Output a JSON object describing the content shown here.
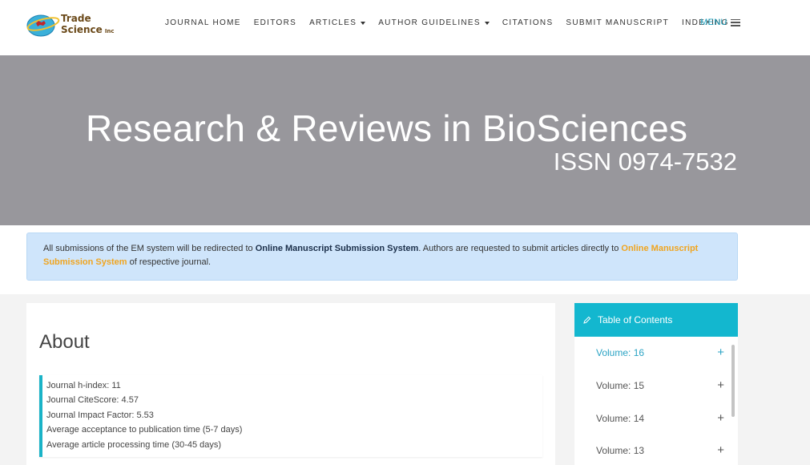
{
  "header": {
    "logo": {
      "line1": "Trade",
      "line2": "Science",
      "suffix": "Inc"
    },
    "nav": [
      {
        "label": "JOURNAL HOME",
        "dropdown": false
      },
      {
        "label": "EDITORS",
        "dropdown": false
      },
      {
        "label": "ARTICLES",
        "dropdown": true
      },
      {
        "label": "AUTHOR GUIDELINES",
        "dropdown": true
      },
      {
        "label": "CITATIONS",
        "dropdown": false
      },
      {
        "label": "SUBMIT MANUSCRIPT",
        "dropdown": false
      },
      {
        "label": "INDEXING",
        "dropdown": false
      }
    ],
    "menu_label": "MENU"
  },
  "hero": {
    "title": "Research & Reviews in BioSciences",
    "issn": "ISSN 0974-7532"
  },
  "notice": {
    "text1": "All submissions of the EM system will be redirected to ",
    "link1": "Online Manuscript Submission System",
    "text2": ". Authors are requested to submit articles directly to ",
    "link2": "Online Manuscript Submission System",
    "text3": " of respective journal."
  },
  "about": {
    "title": "About",
    "metrics": [
      "Journal h-index: 11",
      "Journal CiteScore: 4.57",
      "Journal Impact Factor: 5.53",
      "Average acceptance to publication time (5-7 days)",
      "Average article processing time (30-45 days)"
    ]
  },
  "toc": {
    "title": "Table of Contents",
    "items": [
      {
        "label": "Volume: 16",
        "active": true
      },
      {
        "label": "Volume: 15",
        "active": false
      },
      {
        "label": "Volume: 14",
        "active": false
      },
      {
        "label": "Volume: 13",
        "active": false
      }
    ]
  },
  "colors": {
    "accent": "#13b7cf",
    "link": "#2aa3c4",
    "hero_bg": "#98979c",
    "notice_bg": "#cfe5fb",
    "notice_link": "#f0a520"
  }
}
